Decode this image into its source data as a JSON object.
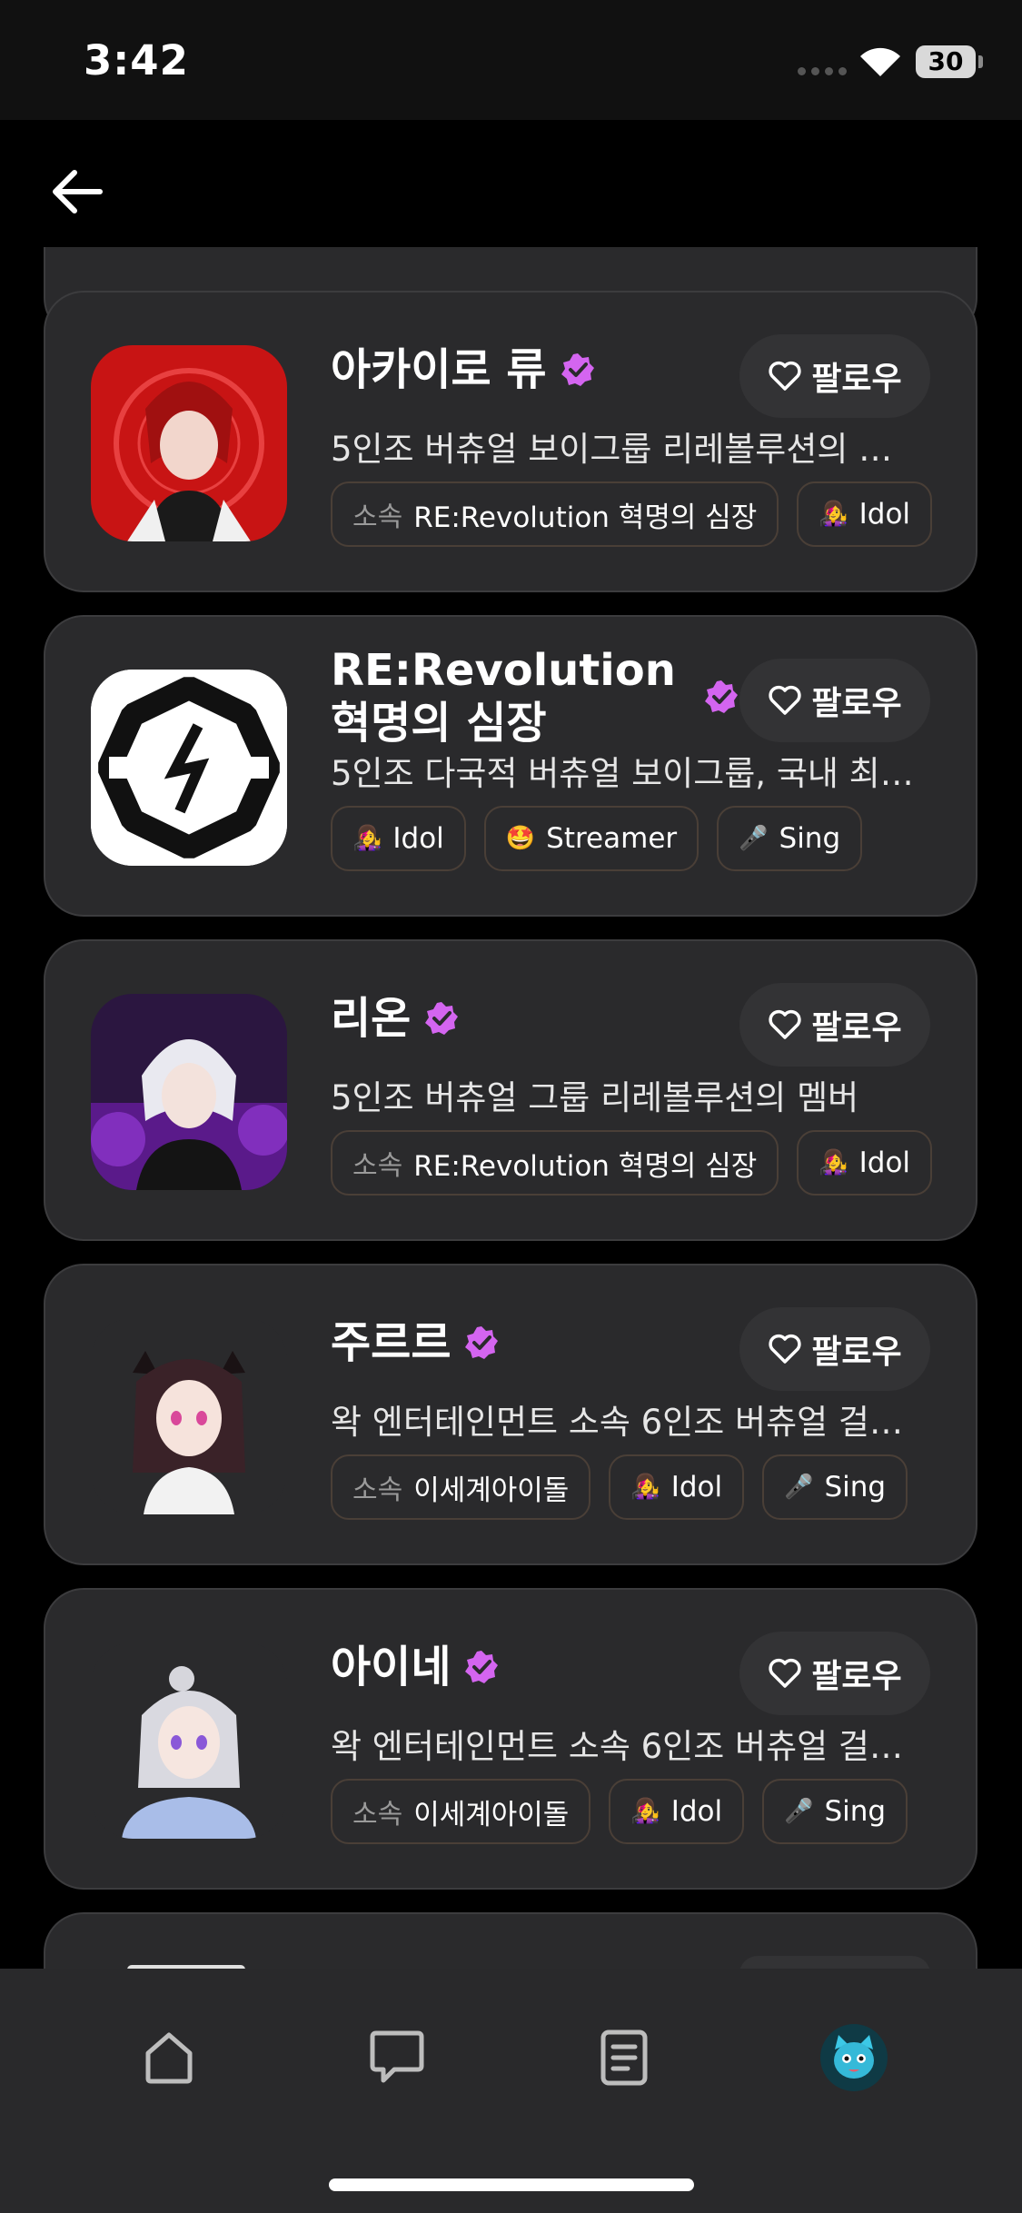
{
  "status_bar": {
    "time": "3:42",
    "battery": "30"
  },
  "colors": {
    "verified": "#d465f0",
    "background": "#000000",
    "card": "#2a2a2c"
  },
  "cards": [
    {
      "name": "아카이로 류",
      "verified": true,
      "follow_label": "팔로우",
      "description": "5인조 버츄얼 보이그룹 리레볼루션의 …",
      "tags": [
        {
          "prefix": "소속",
          "label": "RE:Revolution 혁명의 심장"
        },
        {
          "icon": "idol-icon",
          "label": "Idol"
        }
      ]
    },
    {
      "name_line1": "RE:Revolution",
      "name_line2": "혁명의 심장",
      "verified": true,
      "follow_label": "팔로우",
      "description": "5인조 다국적 버츄얼 보이그룹, 국내 최…",
      "tags": [
        {
          "icon": "idol-icon",
          "label": "Idol"
        },
        {
          "icon": "streamer-icon",
          "label": "Streamer"
        },
        {
          "icon": "mic-icon",
          "label": "Sing"
        }
      ]
    },
    {
      "name": "리온",
      "verified": true,
      "follow_label": "팔로우",
      "description": "5인조 버츄얼 그룹 리레볼루션의 멤버",
      "tags": [
        {
          "prefix": "소속",
          "label": "RE:Revolution 혁명의 심장"
        },
        {
          "icon": "idol-icon",
          "label": "Idol"
        }
      ]
    },
    {
      "name": "주르르",
      "verified": true,
      "follow_label": "팔로우",
      "description": "왁 엔터테인먼트 소속 6인조 버츄얼 걸…",
      "tags": [
        {
          "prefix": "소속",
          "label": "이세계아이돌"
        },
        {
          "icon": "idol-icon",
          "label": "Idol"
        },
        {
          "icon": "mic-icon",
          "label": "Sing"
        }
      ]
    },
    {
      "name": "아이네",
      "verified": true,
      "follow_label": "팔로우",
      "description": "왁 엔터테인먼트 소속 6인조 버츄얼 걸…",
      "tags": [
        {
          "prefix": "소속",
          "label": "이세계아이돌"
        },
        {
          "icon": "idol-icon",
          "label": "Idol"
        },
        {
          "icon": "mic-icon",
          "label": "Sing"
        }
      ]
    }
  ],
  "bottom_nav": [
    {
      "icon": "home-icon"
    },
    {
      "icon": "chat-icon"
    },
    {
      "icon": "document-icon"
    },
    {
      "icon": "profile-avatar"
    }
  ]
}
